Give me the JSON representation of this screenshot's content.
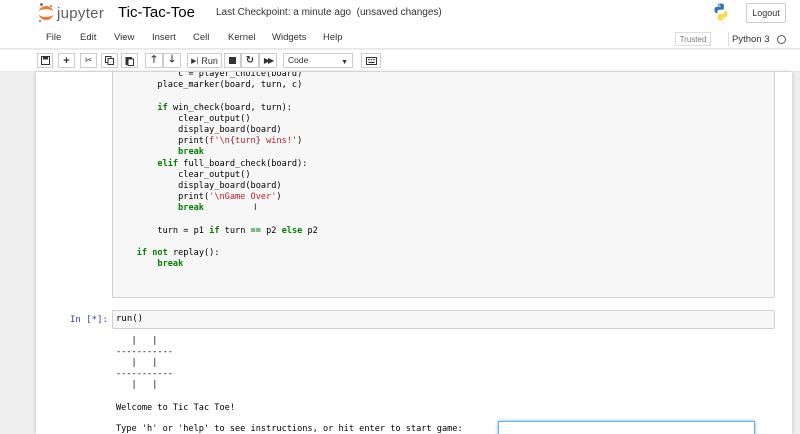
{
  "header": {
    "logo_text": "jupyter",
    "notebook_name": "Tic-Tac-Toe",
    "checkpoint": "Last Checkpoint: a minute ago",
    "unsaved": "(unsaved changes)",
    "logout_label": "Logout"
  },
  "menu": {
    "items": [
      "File",
      "Edit",
      "View",
      "Insert",
      "Cell",
      "Kernel",
      "Widgets",
      "Help"
    ],
    "trusted_label": "Trusted",
    "kernel_name": "Python 3"
  },
  "toolbar": {
    "run_label": "Run",
    "cell_type": "Code"
  },
  "cell1": {
    "lines": [
      "            c = player_choice(board)",
      "        place_marker(board, turn, c)",
      "",
      "        if win_check(board, turn):",
      "            clear_output()",
      "            display_board(board)",
      "            print(f'\\n{turn} wins!')",
      "            break",
      "        elif full_board_check(board):",
      "            clear_output()",
      "            display_board(board)",
      "            print('\\nGame Over')",
      "            break",
      "",
      "        turn = p1 if turn == p2 else p2",
      "",
      "    if not replay():",
      "        break"
    ]
  },
  "cell2": {
    "prompt": "In [*]:",
    "code": "run()",
    "output": {
      "board_lines": [
        "   |   |",
        "-----------",
        "   |   |",
        "-----------",
        "   |   |"
      ],
      "welcome": "Welcome to Tic Tac Toe!",
      "instructions": "Type 'h' or 'help' to see instructions, or hit enter to start game:"
    }
  },
  "colors": {
    "keyword": "#008000",
    "string": "#ba2121",
    "prompt": "#303f9f",
    "jupyter_orange": "#f37726"
  }
}
